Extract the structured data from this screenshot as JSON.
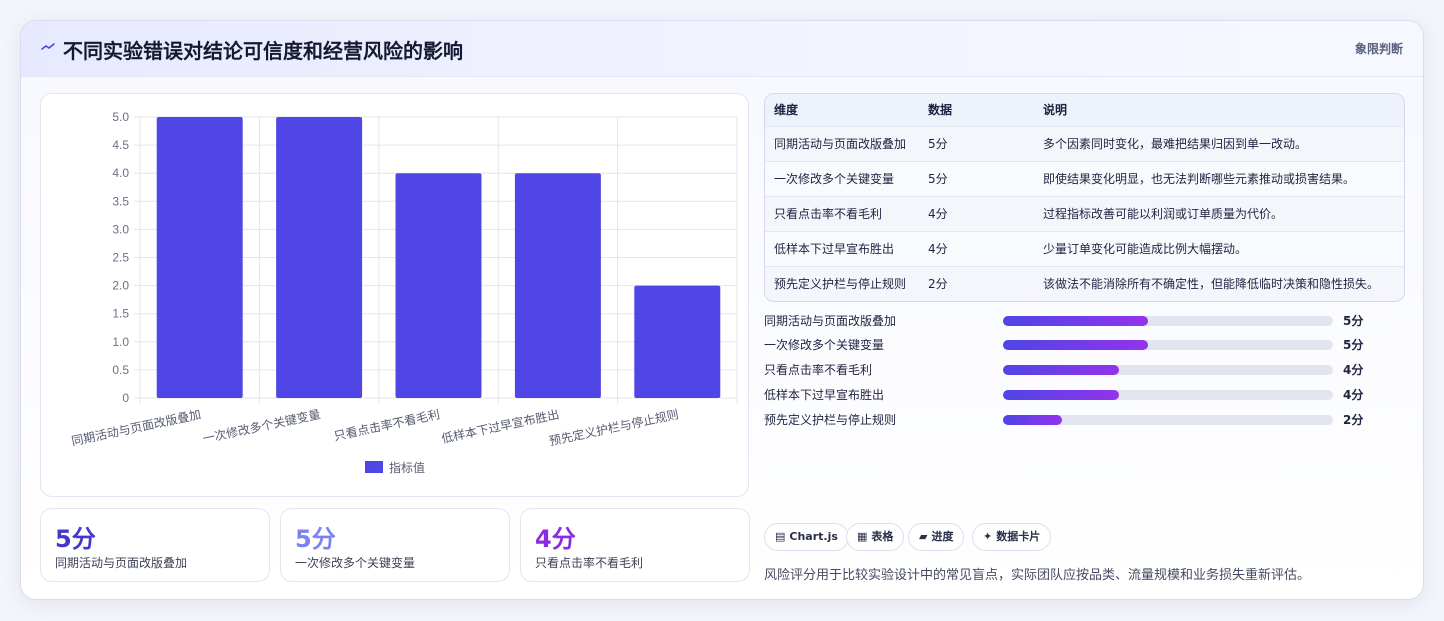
{
  "header": {
    "title": "不同实验错误对结论可信度和经营风险的影响",
    "tag": "象限判断"
  },
  "chart_data": {
    "type": "bar",
    "categories": [
      "同期活动与页面改版叠加",
      "一次修改多个关键变量",
      "只看点击率不看毛利",
      "低样本下过早宣布胜出",
      "预先定义护栏与停止规则"
    ],
    "series": [
      {
        "name": "指标值",
        "values": [
          5,
          5,
          4,
          4,
          2
        ]
      }
    ],
    "ylim": [
      0,
      5
    ],
    "yticks": [
      "0",
      "0.5",
      "1.0",
      "1.5",
      "2.0",
      "2.5",
      "3.0",
      "3.5",
      "4.0",
      "4.5",
      "5.0"
    ],
    "grid": true,
    "legend": "bottom",
    "color": "#4f46e5"
  },
  "kpis": [
    {
      "value": "5分",
      "label": "同期活动与页面改版叠加",
      "color": "#4338ca"
    },
    {
      "value": "5分",
      "label": "一次修改多个关键变量",
      "color": "#7c83f0"
    },
    {
      "value": "4分",
      "label": "只看点击率不看毛利",
      "color": "#8a2be2"
    }
  ],
  "table": {
    "headers": [
      "维度",
      "数据",
      "说明"
    ],
    "rows": [
      [
        "同期活动与页面改版叠加",
        "5分",
        "多个因素同时变化，最难把结果归因到单一改动。"
      ],
      [
        "一次修改多个关键变量",
        "5分",
        "即使结果变化明显，也无法判断哪些元素推动或损害结果。"
      ],
      [
        "只看点击率不看毛利",
        "4分",
        "过程指标改善可能以利润或订单质量为代价。"
      ],
      [
        "低样本下过早宣布胜出",
        "4分",
        "少量订单变化可能造成比例大幅摆动。"
      ],
      [
        "预先定义护栏与停止规则",
        "2分",
        "该做法不能消除所有不确定性，但能降低临时决策和隐性损失。"
      ]
    ]
  },
  "progress": [
    {
      "label": "同期活动与页面改版叠加",
      "value": "5分",
      "pct": 44
    },
    {
      "label": "一次修改多个关键变量",
      "value": "5分",
      "pct": 44
    },
    {
      "label": "只看点击率不看毛利",
      "value": "4分",
      "pct": 35
    },
    {
      "label": "低样本下过早宣布胜出",
      "value": "4分",
      "pct": 35
    },
    {
      "label": "预先定义护栏与停止规则",
      "value": "2分",
      "pct": 18
    }
  ],
  "chips": [
    {
      "icon": "▤",
      "label": "Chart.js"
    },
    {
      "icon": "▦",
      "label": "表格"
    },
    {
      "icon": "▰",
      "label": "进度"
    },
    {
      "icon": "✦",
      "label": "数据卡片"
    }
  ],
  "note": "风险评分用于比较实验设计中的常见盲点，实际团队应按品类、流量规模和业务损失重新评估。"
}
